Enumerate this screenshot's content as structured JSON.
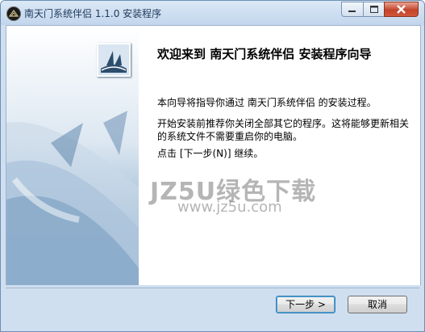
{
  "window": {
    "title": "南天门系统伴侣 1.1.0 安装程序"
  },
  "content": {
    "heading": "欢迎来到 南天门系统伴侣 安装程序向导",
    "paragraph1": "本向导将指导你通过 南天门系统伴侣 的安装过程。",
    "paragraph2": "开始安装前推荐你关闭全部其它的程序。这将能够更新相关的系统文件不需要重启你的电脑。",
    "paragraph3": "点击 [下一步(N)] 继续。"
  },
  "watermark": {
    "line1": "JZ5U绿色下载",
    "line2": "www.jz5u.com"
  },
  "buttons": {
    "next": "下一步 >",
    "cancel": "取消"
  }
}
